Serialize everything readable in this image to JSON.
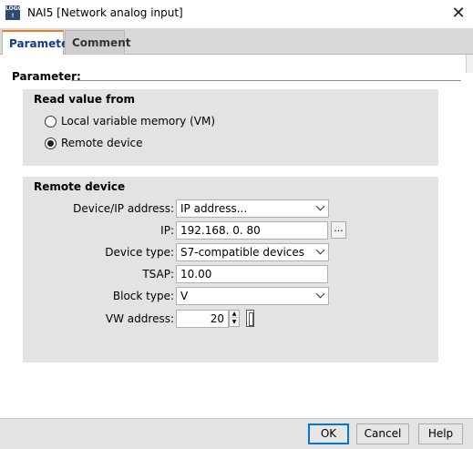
{
  "window": {
    "title": "NAI5 [Network analog input]",
    "icon_text_top": "LOGO",
    "icon_text_bottom": "!"
  },
  "tabs": [
    {
      "label": "Parameter",
      "active": true
    },
    {
      "label": "Comment",
      "active": false
    }
  ],
  "parameter_section": {
    "header": "Parameter:"
  },
  "read_value": {
    "title": "Read value from",
    "options": [
      {
        "label": "Local variable memory (VM)",
        "checked": false
      },
      {
        "label": "Remote device",
        "checked": true
      }
    ]
  },
  "remote_device": {
    "title": "Remote device",
    "device_ip_label": "Device/IP address:",
    "device_ip_value": "IP address...",
    "ip_label": "IP:",
    "ip_value": "192.168.  0. 80",
    "ip_button": "...",
    "device_type_label": "Device type:",
    "device_type_value": "S7-compatible devices",
    "tsap_label": "TSAP:",
    "tsap_value": "10.00",
    "block_type_label": "Block type:",
    "block_type_value": "V",
    "vw_address_label": "VW address:",
    "vw_address_value": "20"
  },
  "footer": {
    "ok": "OK",
    "cancel": "Cancel",
    "help": "Help"
  },
  "colors": {
    "accent": "#0078d7",
    "tab_top_accent": "#e67e22",
    "group_bg": "#e3e3e3",
    "tab_label": "#163a8a"
  }
}
